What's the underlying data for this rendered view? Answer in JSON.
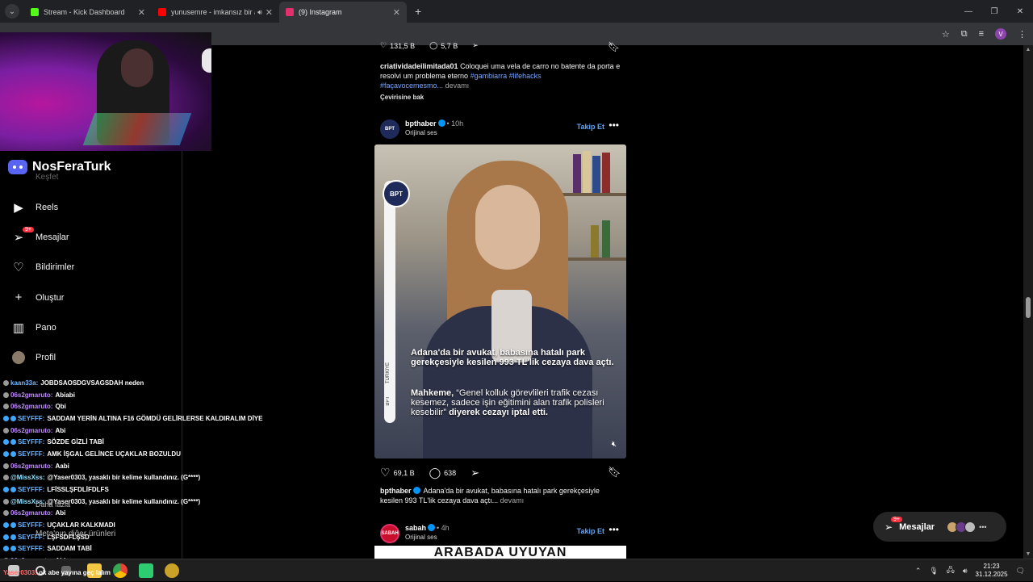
{
  "browser": {
    "tabs": [
      {
        "title": "Stream - Kick Dashboard",
        "favicon_color": "#53fc18",
        "active": false,
        "audio": false
      },
      {
        "title": "yunusemre - imkansız bir a",
        "favicon_color": "#ff0000",
        "active": false,
        "audio": true
      },
      {
        "title": "(9) Instagram",
        "favicon_color": "#e1306c",
        "active": true,
        "audio": false
      }
    ],
    "new_tab": "+",
    "profile_initial": "V"
  },
  "overlay": {
    "brand_name": "NosFeraTurk",
    "partial_nav_label": "Keşfet"
  },
  "sidebar": {
    "items": [
      {
        "label": "Reels",
        "icon": "reels-icon",
        "badge": ""
      },
      {
        "label": "Mesajlar",
        "icon": "messenger-icon",
        "badge": "9+"
      },
      {
        "label": "Bildirimler",
        "icon": "heart-icon",
        "badge": ""
      },
      {
        "label": "Oluştur",
        "icon": "plus-icon",
        "badge": ""
      },
      {
        "label": "Pano",
        "icon": "dashboard-icon",
        "badge": ""
      },
      {
        "label": "Profil",
        "icon": "profile-avatar",
        "badge": ""
      }
    ],
    "ghost_items": [
      "Daha fazla",
      "Meta'nın diğer ürünleri"
    ]
  },
  "chat": {
    "lines": [
      {
        "user": "kaan33a:",
        "text": "JOBDSAOSDGVSAGSDAH neden",
        "color": "#7ab8ff",
        "badges": 1
      },
      {
        "user": "06s2gmaruto:",
        "text": "Abiabi",
        "color": "#c08cff",
        "badges": 1
      },
      {
        "user": "06s2gmaruto:",
        "text": "Qbi",
        "color": "#c08cff",
        "badges": 1
      },
      {
        "user": "SEYFFF:",
        "text": "SADDAM YERİN ALTINA F16 GÖMDÜ GELİRLERSE KALDIRALIM DİYE",
        "color": "#6fb7ff",
        "badges": 2
      },
      {
        "user": "06s2gmaruto:",
        "text": "Abi",
        "color": "#c08cff",
        "badges": 1
      },
      {
        "user": "SEYFFF:",
        "text": "SÖZDE GİZLİ TABİ",
        "color": "#6fb7ff",
        "badges": 2
      },
      {
        "user": "SEYFFF:",
        "text": "AMK İŞGAL GELİNCE UÇAKLAR BOZULDU",
        "color": "#6fb7ff",
        "badges": 2
      },
      {
        "user": "06s2gmaruto:",
        "text": "Aabi",
        "color": "#c08cff",
        "badges": 1
      },
      {
        "user": "@MissXss:",
        "text": "@Yaser0303, yasaklı bir kelime kullandınız. (G****)",
        "color": "#8fe3ff",
        "badges": 1
      },
      {
        "user": "SEYFFF:",
        "text": "LFİSSLŞFDLİFDLFS",
        "color": "#6fb7ff",
        "badges": 2
      },
      {
        "user": "@MissXss:",
        "text": "@Yaser0303, yasaklı bir kelime kullandınız. (G****)",
        "color": "#8fe3ff",
        "badges": 1
      },
      {
        "user": "06s2gmaruto:",
        "text": "Abi",
        "color": "#c08cff",
        "badges": 1
      },
      {
        "user": "SEYFFF:",
        "text": "UÇAKLAR KALKMADI",
        "color": "#6fb7ff",
        "badges": 2
      },
      {
        "user": "SEYFFF:",
        "text": "LŞFSDFLŞSD",
        "color": "#6fb7ff",
        "badges": 2
      },
      {
        "user": "SEYFFF:",
        "text": "SADDAM TABİ",
        "color": "#6fb7ff",
        "badges": 2
      },
      {
        "user": "06s2gmaruto:",
        "text": "Abi",
        "color": "#c08cff",
        "badges": 1
      }
    ],
    "taskbar_line_user": "Yaser0303:",
    "taskbar_line_text": "ok abe yayına geç lalım"
  },
  "feed": {
    "top_post": {
      "likes": "131,5 B",
      "comments": "5,7 B",
      "caption_user": "criatividadeilimitada01",
      "caption_text": "Coloquei uma vela de carro no batente da porta e resolvi um problema eterno",
      "tags": "#gambiarra #lifehacks",
      "tags2": "#façavocemesmo...",
      "more": "devamı",
      "translate": "Çevirisine bak"
    },
    "post1": {
      "username": "bpthaber",
      "time": "10h",
      "audio": "Orijinal ses",
      "follow": "Takip Et",
      "logo": "BPT",
      "side_label": "TÜRKİYE",
      "side_label2": "BPT",
      "video_headline": "Adana'da bir avukat, babasına hatalı park gerekçesiyle kesilen 993 TL'lik cezaya dava açtı.",
      "video_quote_bold": "Mahkeme,",
      "video_quote": " “Genel kolluk görevlileri trafik cezası kesemez, sadece işin eğitimini alan trafik polisleri kesebilir” ",
      "video_quote_end": "diyerek cezayı iptal etti.",
      "likes": "69,1 B",
      "comments": "638",
      "caption_user": "bpthaber",
      "caption_text": "Adana'da bir avukat, babasına hatalı park gerekçesiyle kesilen 993 TL'lik cezaya dava açtı...",
      "more": "devamı"
    },
    "post2": {
      "username": "sabah",
      "time": "4h",
      "audio": "Orijinal ses",
      "follow": "Takip Et",
      "logo": "SABAH",
      "video_headline": "ARABADA UYUYAN"
    }
  },
  "messages_pill": {
    "label": "Mesajlar",
    "badge": "9+"
  },
  "taskbar": {
    "time": "21:23",
    "date": "31.12.2025"
  },
  "colors": {
    "accent_blue": "#0095f6",
    "follow_blue": "#5ea4ff",
    "badge_red": "#ff3040",
    "bg": "#000000"
  }
}
